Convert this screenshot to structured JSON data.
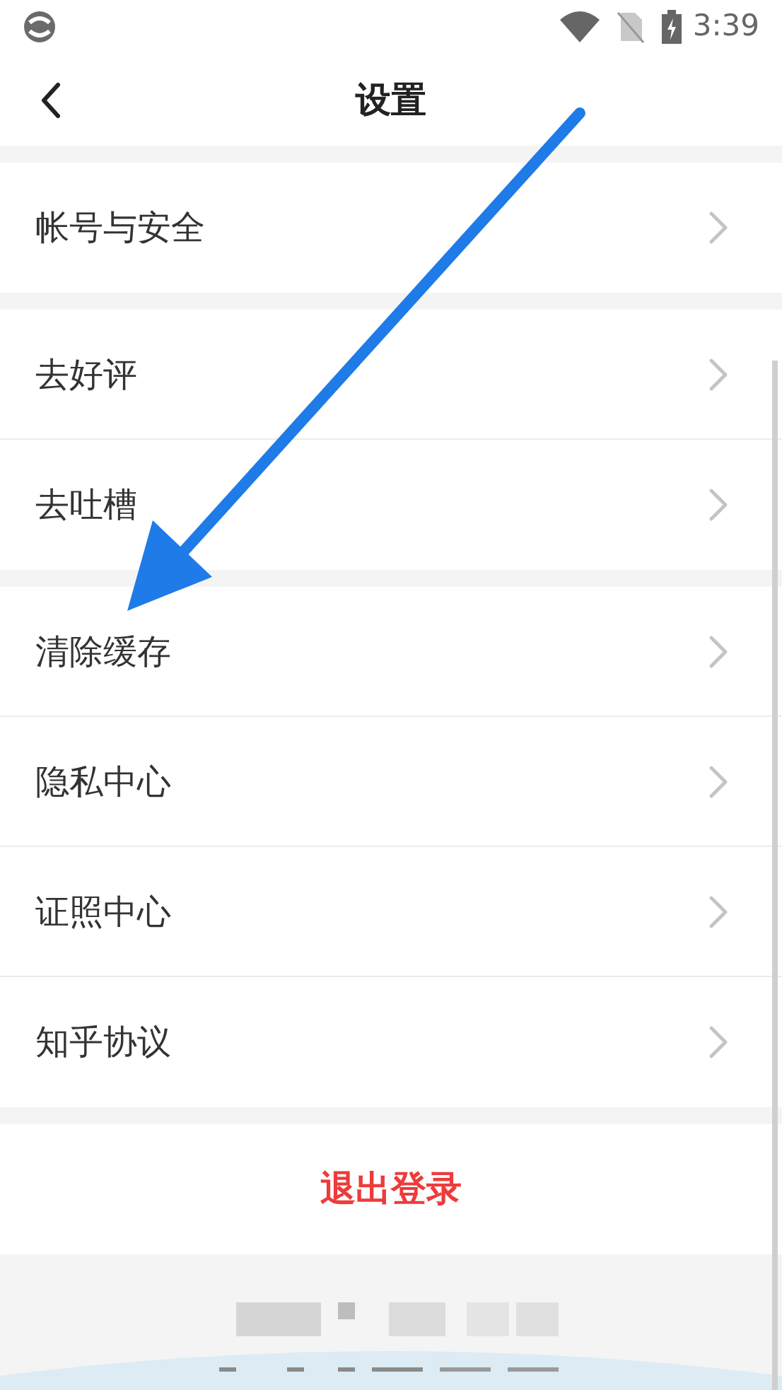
{
  "status_bar": {
    "time": "3:39"
  },
  "header": {
    "title": "设置"
  },
  "groups": [
    {
      "items": [
        {
          "label": "帐号与安全"
        }
      ]
    },
    {
      "items": [
        {
          "label": "去好评"
        },
        {
          "label": "去吐槽"
        }
      ]
    },
    {
      "items": [
        {
          "label": "清除缓存"
        },
        {
          "label": "隐私中心"
        },
        {
          "label": "证照中心"
        },
        {
          "label": "知乎协议"
        }
      ]
    }
  ],
  "logout": {
    "label": "退出登录"
  }
}
